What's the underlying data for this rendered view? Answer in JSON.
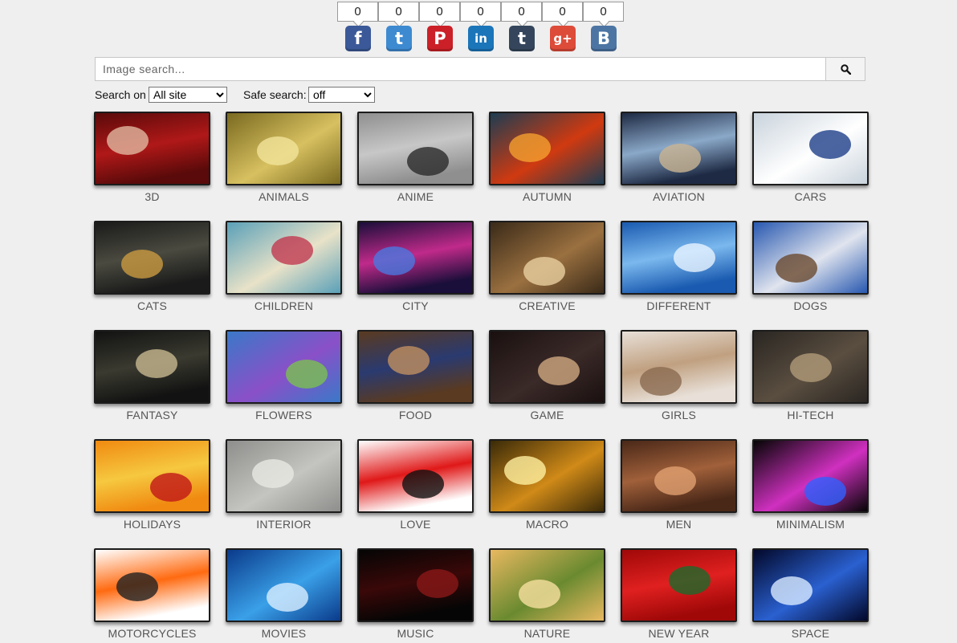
{
  "share": [
    {
      "network": "facebook",
      "icon": "facebook-icon",
      "glyph": "f",
      "color": "#3b5998",
      "count": "0"
    },
    {
      "network": "twitter",
      "icon": "twitter-icon",
      "glyph": "t",
      "color": "#3d8ad1",
      "count": "0"
    },
    {
      "network": "pinterest",
      "icon": "pinterest-icon",
      "glyph": "P",
      "color": "#cb2027",
      "count": "0"
    },
    {
      "network": "linkedin",
      "icon": "linkedin-icon",
      "glyph": "in",
      "color": "#1b75b9",
      "count": "0"
    },
    {
      "network": "tumblr",
      "icon": "tumblr-icon",
      "glyph": "t",
      "color": "#35465c",
      "count": "0"
    },
    {
      "network": "googleplus",
      "icon": "googleplus-icon",
      "glyph": "g+",
      "color": "#dd4b39",
      "count": "0"
    },
    {
      "network": "vkontakte",
      "icon": "vk-icon",
      "glyph": "B",
      "color": "#4c75a3",
      "count": "0"
    }
  ],
  "search": {
    "placeholder": "Image search...",
    "button_icon": "search-icon"
  },
  "options": {
    "search_on_label": "Search on",
    "search_on_value": "All site",
    "safe_search_label": "Safe search:",
    "safe_search_value": "off"
  },
  "categories": [
    {
      "label": "3D",
      "palette": [
        "#5a0a0a",
        "#b01818",
        "#e0b8a0"
      ]
    },
    {
      "label": "ANIMALS",
      "palette": [
        "#7a6a20",
        "#d7c060",
        "#f1e39a"
      ]
    },
    {
      "label": "ANIME",
      "palette": [
        "#8f8f8f",
        "#c7c7c7",
        "#2a2a2a"
      ]
    },
    {
      "label": "AUTUMN",
      "palette": [
        "#1d3d52",
        "#d03a10",
        "#f4a030"
      ]
    },
    {
      "label": "AVIATION",
      "palette": [
        "#1e2a44",
        "#8aa8c8",
        "#c9b492"
      ]
    },
    {
      "label": "CARS",
      "palette": [
        "#c9d3dc",
        "#ffffff",
        "#1e3f8a"
      ]
    },
    {
      "label": "CATS",
      "palette": [
        "#1a1a1a",
        "#4a4a40",
        "#c99a40"
      ]
    },
    {
      "label": "CHILDREN",
      "palette": [
        "#5aa0b8",
        "#e8e2c8",
        "#c03a50"
      ]
    },
    {
      "label": "CITY",
      "palette": [
        "#1a0e3a",
        "#c02a8a",
        "#4a78e0"
      ]
    },
    {
      "label": "CREATIVE",
      "palette": [
        "#3a2a18",
        "#9a7040",
        "#e8d0a0"
      ]
    },
    {
      "label": "DIFFERENT",
      "palette": [
        "#1a5ab0",
        "#7ab8ee",
        "#e8f4ff"
      ]
    },
    {
      "label": "DOGS",
      "palette": [
        "#2858b0",
        "#e0e4ee",
        "#6a4a30"
      ]
    },
    {
      "label": "FANTASY",
      "palette": [
        "#121212",
        "#3a3a30",
        "#c8b890"
      ]
    },
    {
      "label": "FLOWERS",
      "palette": [
        "#3a78c8",
        "#8a50c8",
        "#7ac050"
      ]
    },
    {
      "label": "FOOD",
      "palette": [
        "#5a3a20",
        "#2a3a70",
        "#c09060"
      ]
    },
    {
      "label": "GAME",
      "palette": [
        "#1a1010",
        "#3a2a28",
        "#d0a880"
      ]
    },
    {
      "label": "GIRLS",
      "palette": [
        "#e8e0d8",
        "#c0a080",
        "#8a6a50"
      ]
    },
    {
      "label": "HI-TECH",
      "palette": [
        "#2a2622",
        "#5a4e40",
        "#b09a78"
      ]
    },
    {
      "label": "HOLIDAYS",
      "palette": [
        "#f08a10",
        "#f6c840",
        "#c01818"
      ]
    },
    {
      "label": "INTERIOR",
      "palette": [
        "#8e8e8c",
        "#c4c4c0",
        "#e8e8e4"
      ]
    },
    {
      "label": "LOVE",
      "palette": [
        "#ffffff",
        "#e01818",
        "#111111"
      ]
    },
    {
      "label": "MACRO",
      "palette": [
        "#3a2a08",
        "#d08a18",
        "#fff0a0"
      ]
    },
    {
      "label": "MEN",
      "palette": [
        "#4a2818",
        "#a0603a",
        "#e0a070"
      ]
    },
    {
      "label": "MINIMALISM",
      "palette": [
        "#050505",
        "#d030c0",
        "#3060ff"
      ]
    },
    {
      "label": "MOTORCYCLES",
      "palette": [
        "#ffffff",
        "#ff6a10",
        "#222222"
      ]
    },
    {
      "label": "MOVIES",
      "palette": [
        "#0a3a8a",
        "#3aa0e8",
        "#d8eeff"
      ]
    },
    {
      "label": "MUSIC",
      "palette": [
        "#050505",
        "#3a0808",
        "#8a1818"
      ]
    },
    {
      "label": "NATURE",
      "palette": [
        "#e8b860",
        "#6a8a30",
        "#f6e0a0"
      ]
    },
    {
      "label": "NEW YEAR",
      "palette": [
        "#a00808",
        "#e02020",
        "#1a6a2a"
      ]
    },
    {
      "label": "SPACE",
      "palette": [
        "#02082a",
        "#2a60d0",
        "#d8eaff"
      ]
    }
  ]
}
